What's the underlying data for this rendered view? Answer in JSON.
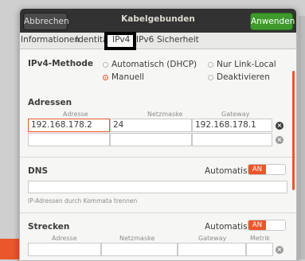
{
  "window": {
    "title": "Kabelgebunden",
    "cancel_label": "Abbrechen",
    "apply_label": "Anwenden"
  },
  "tabs": [
    {
      "label": "Informationen"
    },
    {
      "label": "Identität"
    },
    {
      "label": "IPv4"
    },
    {
      "label": "IPv6"
    },
    {
      "label": "Sicherheit"
    }
  ],
  "ipv4": {
    "method_label": "IPv4-Methode",
    "options": {
      "dhcp": "Automatisch (DHCP)",
      "manual": "Manuell",
      "link_local": "Nur Link-Local",
      "disabled": "Deaktivieren"
    },
    "selected": "Manuell"
  },
  "addresses": {
    "section_label": "Adressen",
    "headers": {
      "address": "Adresse",
      "netmask": "Netzmaske",
      "gateway": "Gateway"
    },
    "rows": [
      {
        "address": "192.168.178.2",
        "netmask": "24",
        "gateway": "192.168.178.1"
      },
      {
        "address": "",
        "netmask": "",
        "gateway": ""
      }
    ]
  },
  "dns": {
    "section_label": "DNS",
    "auto_label": "Automatisch",
    "toggle_state": "AN",
    "value": "",
    "hint": "IP-Adressen durch Kommata trennen"
  },
  "routes": {
    "section_label": "Strecken",
    "auto_label": "Automatisch",
    "toggle_state": "AN",
    "headers": {
      "address": "Adresse",
      "netmask": "Netzmaske",
      "gateway": "Gateway",
      "metric": "Metrik"
    }
  },
  "colors": {
    "accent": "#e9572b",
    "apply_green": "#3e9a2a",
    "titlebar": "#323232"
  }
}
